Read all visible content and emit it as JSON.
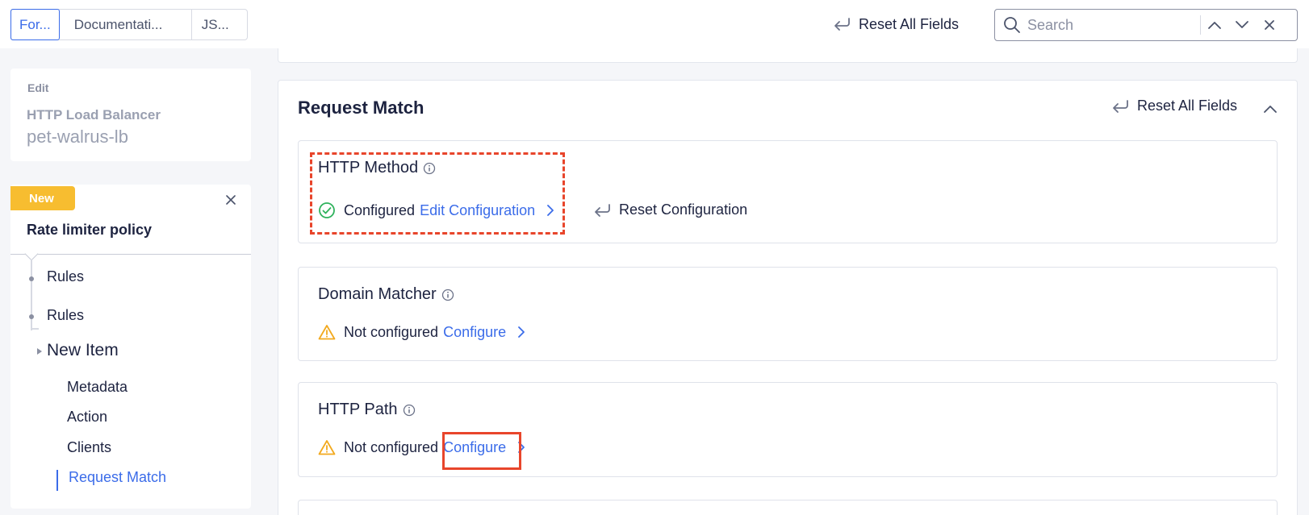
{
  "tabs": [
    {
      "label": "For...",
      "active": true
    },
    {
      "label": "Documentati...",
      "active": false
    },
    {
      "label": "JS...",
      "active": false
    }
  ],
  "toolbar": {
    "reset_all_label": "Reset All Fields",
    "search_placeholder": "Search"
  },
  "sidebar": {
    "edit_label": "Edit",
    "lb_type": "HTTP Load Balancer",
    "lb_name": "pet-walrus-lb",
    "policy": {
      "badge": "New",
      "title": "Rate limiter policy",
      "items": [
        {
          "label": "Rules"
        },
        {
          "label": "Rules"
        },
        {
          "label": "New Item"
        },
        {
          "label": "Metadata"
        },
        {
          "label": "Action"
        },
        {
          "label": "Clients"
        },
        {
          "label": "Request Match",
          "active": true
        }
      ]
    }
  },
  "main": {
    "section_title": "Request Match",
    "section_reset_label": "Reset All Fields",
    "fields": [
      {
        "title": "HTTP Method",
        "status": "Configured",
        "status_type": "ok",
        "action": "Edit Configuration",
        "reset_label": "Reset Configuration"
      },
      {
        "title": "Domain Matcher",
        "status": "Not configured",
        "status_type": "warning",
        "action": "Configure"
      },
      {
        "title": "HTTP Path",
        "status": "Not configured",
        "status_type": "warning",
        "action": "Configure"
      }
    ]
  },
  "colors": {
    "accent": "#3b6ce9",
    "badge": "#f7bd30",
    "success": "#2fb25c",
    "warning": "#f2a91e",
    "highlight": "#e8452b"
  }
}
